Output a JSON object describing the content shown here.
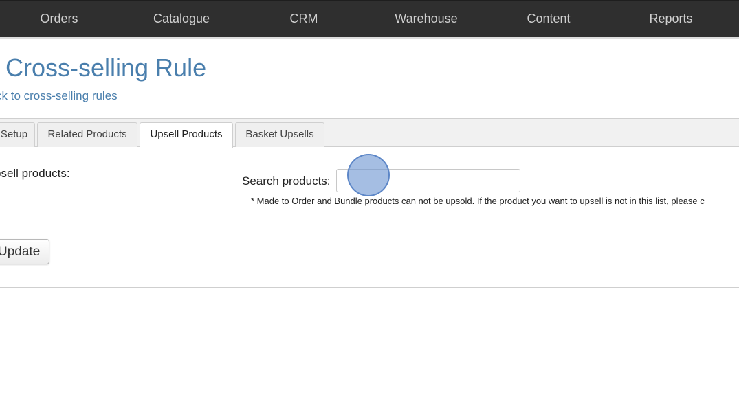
{
  "nav": {
    "items": [
      {
        "label": "Orders"
      },
      {
        "label": "Catalogue"
      },
      {
        "label": "CRM"
      },
      {
        "label": "Warehouse"
      },
      {
        "label": "Content"
      },
      {
        "label": "Reports"
      }
    ]
  },
  "header": {
    "title": "t Cross-selling Rule",
    "back_link": "ck to cross-selling rules"
  },
  "tabs": [
    {
      "label": "Setup",
      "active": false
    },
    {
      "label": "Related Products",
      "active": false
    },
    {
      "label": "Upsell Products",
      "active": true
    },
    {
      "label": "Basket Upsells",
      "active": false
    }
  ],
  "form": {
    "section_label": "psell products:",
    "search_label": "Search products:",
    "search_value": "",
    "note": "* Made to Order and Bundle products can not be upsold. If the product you want to upsell is not in this list, please c",
    "update_label": "Update"
  },
  "colors": {
    "nav_bg": "#2f2f2f",
    "nav_text": "#cfcfcf",
    "link": "#4a7fad",
    "click_marker": "#6e96d2"
  }
}
